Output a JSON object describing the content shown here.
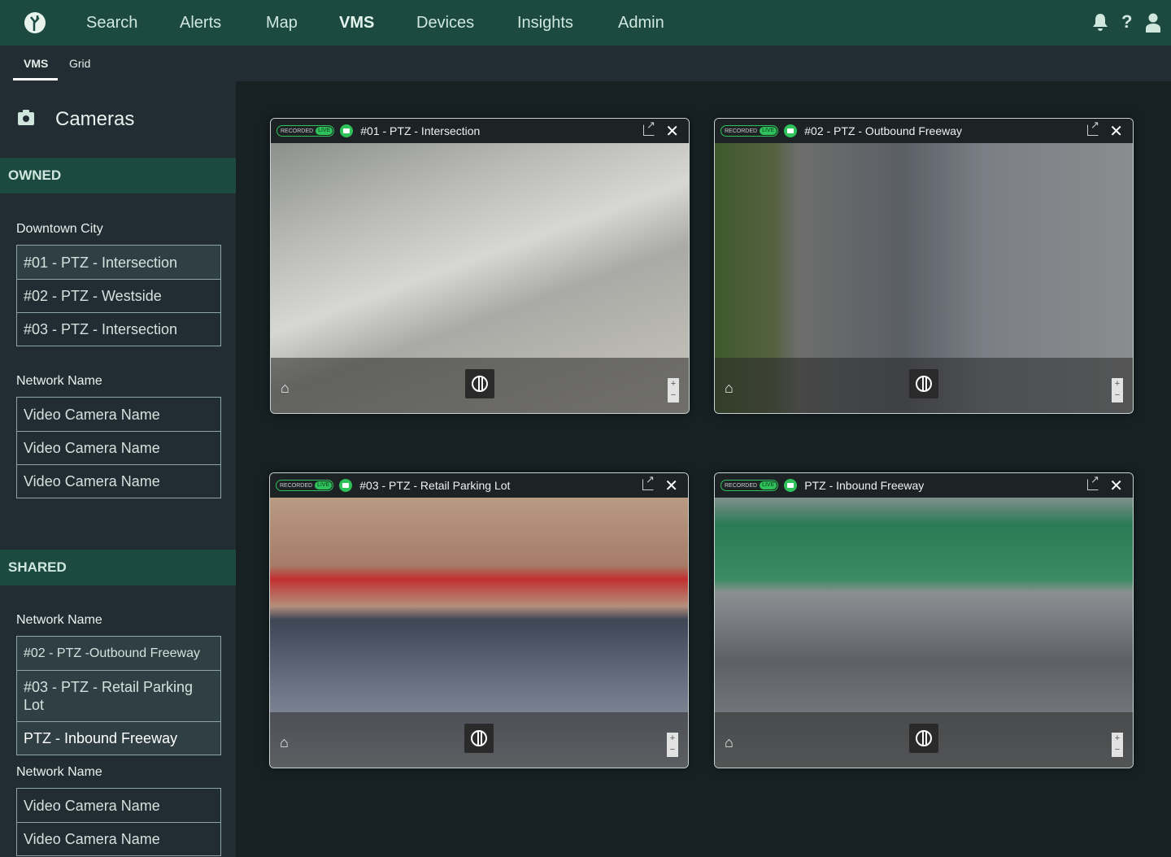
{
  "nav": {
    "items": [
      "Search",
      "Alerts",
      "Map",
      "VMS",
      "Devices",
      "Insights",
      "Admin"
    ],
    "active": "VMS"
  },
  "icons": {
    "logo": "tree-logo",
    "bell": "bell-icon",
    "help": "help-icon",
    "user": "user-icon"
  },
  "subtabs": [
    "VMS",
    "Grid"
  ],
  "sidebar": {
    "title": "Cameras",
    "owned": {
      "label": "OWNED",
      "groups": [
        {
          "name": "Downtown City",
          "items": [
            "#01 - PTZ -  Intersection",
            "#02 - PTZ - Westside",
            "#03 - PTZ - Intersection"
          ]
        },
        {
          "name": "Network Name",
          "items": [
            "Video Camera Name",
            "Video Camera Name",
            "Video Camera Name"
          ]
        }
      ]
    },
    "shared": {
      "label": "SHARED",
      "groups": [
        {
          "name": "Network Name",
          "items": [
            "#02 - PTZ -Outbound Freeway",
            "#03 - PTZ - Retail Parking Lot",
            "PTZ - Inbound Freeway"
          ]
        },
        {
          "name": "Network Name",
          "items": [
            "Video Camera Name",
            "Video Camera Name"
          ]
        }
      ]
    }
  },
  "badge": {
    "recorded": "RECORDED",
    "live": "LIVE"
  },
  "colors": {
    "header": "#1c4a40",
    "live": "#2fc25a",
    "sidebar": "#222d33"
  },
  "cards": [
    {
      "title": "#01 - PTZ - Intersection"
    },
    {
      "title": "#02 - PTZ - Outbound Freeway"
    },
    {
      "title": "#03 - PTZ - Retail Parking Lot"
    },
    {
      "title": "PTZ - Inbound Freeway"
    }
  ],
  "zoom": {
    "plus": "+",
    "minus": "−"
  }
}
